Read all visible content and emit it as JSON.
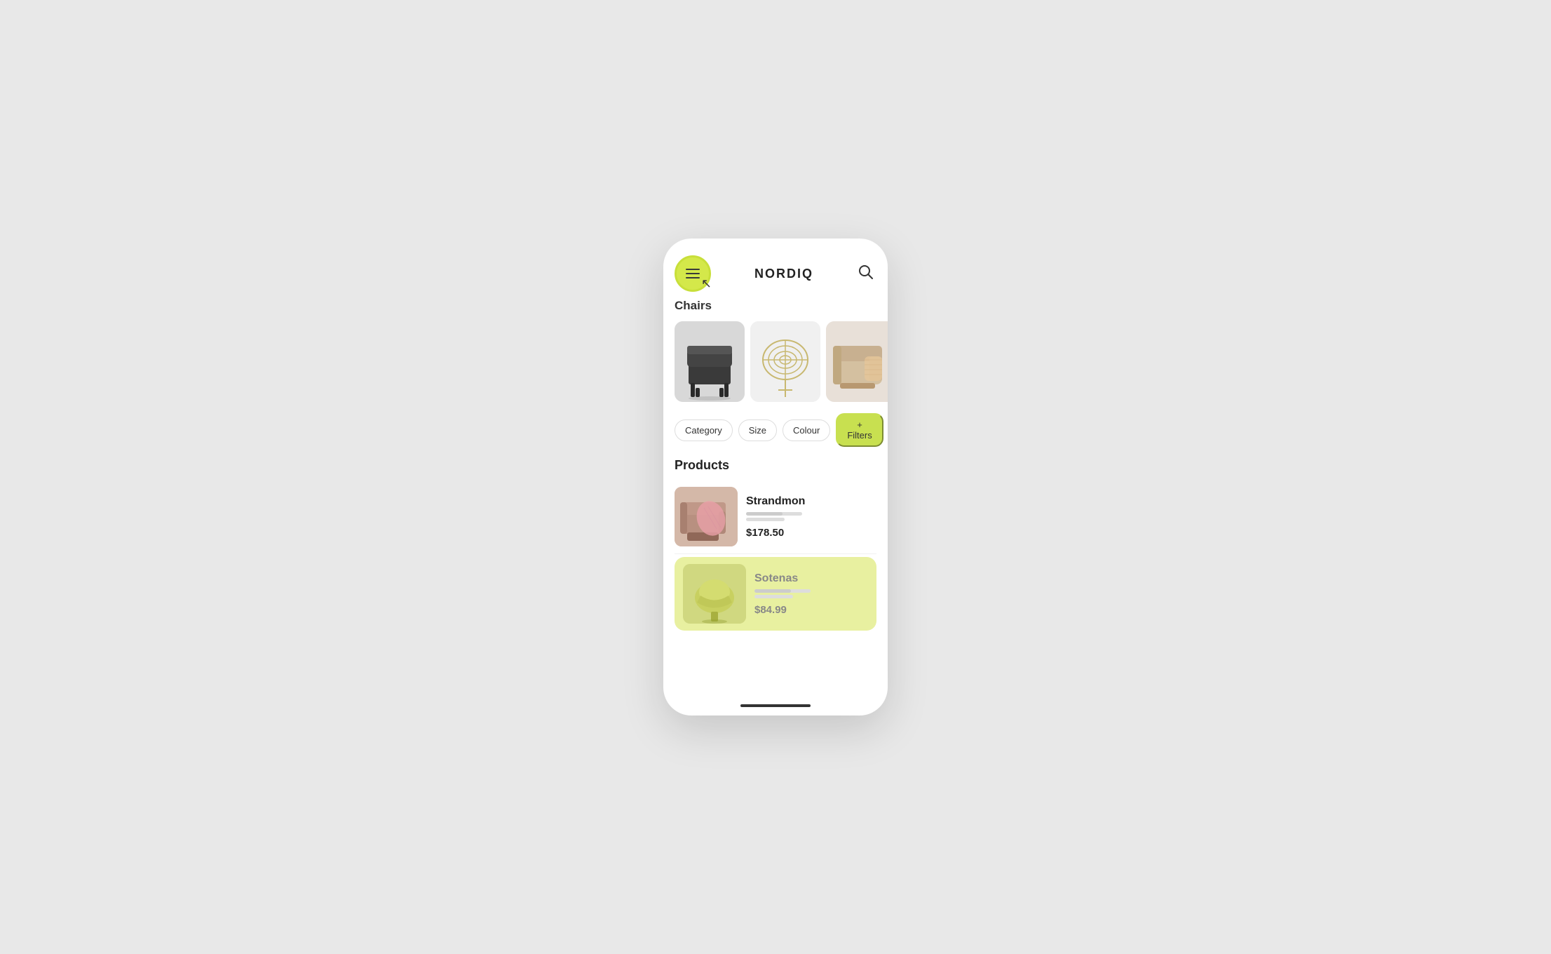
{
  "app": {
    "name": "NORDIQ"
  },
  "header": {
    "menu_label": "Menu",
    "search_label": "Search"
  },
  "category": {
    "name": "Chairs"
  },
  "filters": {
    "items": [
      {
        "label": "Category",
        "active": false
      },
      {
        "label": "Size",
        "active": false
      },
      {
        "label": "Colour",
        "active": false
      },
      {
        "label": "+ Filters",
        "active": true
      }
    ]
  },
  "products": {
    "section_title": "Products",
    "items": [
      {
        "name": "Strandmon",
        "price": "$178.50",
        "highlighted": false
      },
      {
        "name": "Sotenas",
        "price": "$84.99",
        "highlighted": true
      }
    ]
  },
  "colors": {
    "accent": "#c8e050",
    "accent_light": "#d4e84a",
    "highlight_bg": "#e8f0a0"
  }
}
